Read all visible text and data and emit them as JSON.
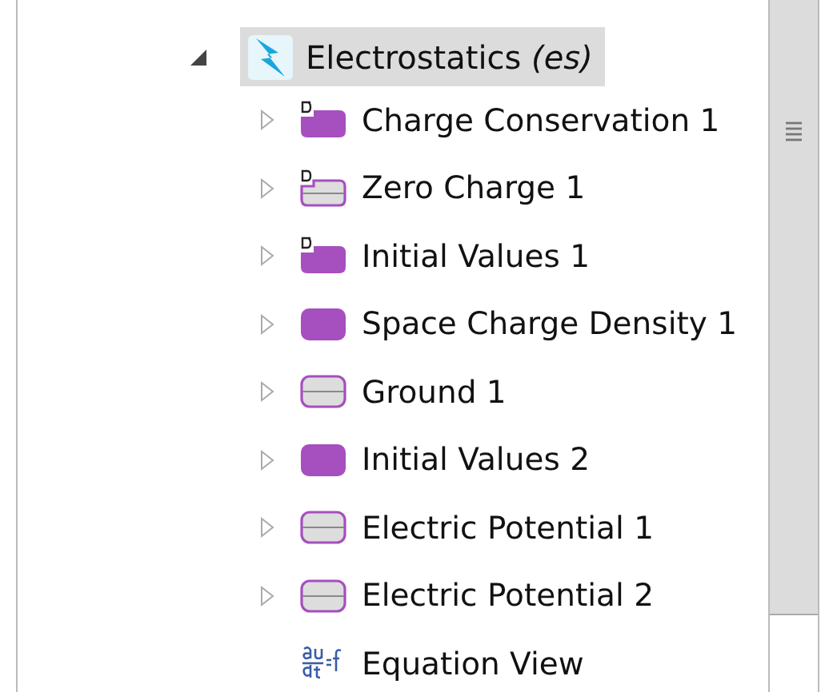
{
  "tree": {
    "label": "Electrostatics *(es)*",
    "expanded": true,
    "selected": true,
    "children": [
      {
        "label": "Charge Conservation 1",
        "kind": "domain-default",
        "expandable": true
      },
      {
        "label": "Zero Charge 1",
        "kind": "boundary-default",
        "expandable": true
      },
      {
        "label": "Initial Values 1",
        "kind": "domain-default",
        "expandable": true
      },
      {
        "label": "Space Charge Density 1",
        "kind": "domain",
        "expandable": true
      },
      {
        "label": "Ground 1",
        "kind": "boundary",
        "expandable": true
      },
      {
        "label": "Initial Values 2",
        "kind": "domain",
        "expandable": true
      },
      {
        "label": "Electric Potential 1",
        "kind": "boundary",
        "expandable": true
      },
      {
        "label": "Electric Potential 2",
        "kind": "boundary",
        "expandable": true
      },
      {
        "label": "Equation View",
        "kind": "equation",
        "expandable": false
      }
    ]
  }
}
